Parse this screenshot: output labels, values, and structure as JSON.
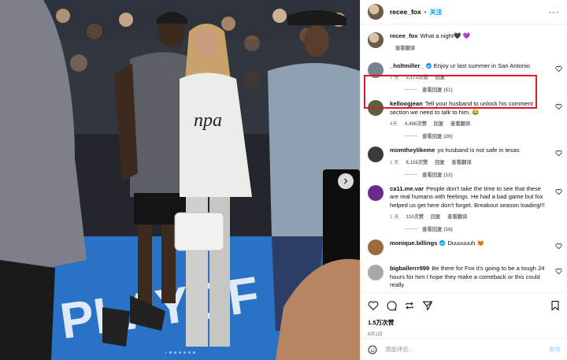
{
  "post": {
    "owner": "recee_fox",
    "follow_label": "关注",
    "more_icon": "more-horizontal-icon",
    "image_alt": "Two people posing on a basketball court after a game"
  },
  "caption": {
    "user": "recee_fox",
    "text": "What a night🖤 💜"
  },
  "comments": [
    {
      "user": "_holtmiller_",
      "verified": true,
      "text": "Enjoy ur last summer in San Antonio",
      "time": "1 天",
      "likes": "3,173次赞",
      "reply": "回复",
      "translate": "",
      "view_replies": "查看回复 (51)",
      "avatar_color": "#7a8391"
    },
    {
      "user": "kelloogjean",
      "verified": false,
      "text": "Tell your husband to unlock his comment section we need to talk to him. 😂",
      "time": "4天",
      "likes": "4,486次赞",
      "reply": "回复",
      "translate": "查看翻译",
      "view_replies": "查看回复 (26)",
      "avatar_color": "#55643d"
    },
    {
      "user": "momtheylikeme",
      "verified": false,
      "text": "yo husband is not safe in texas",
      "time": "1 天",
      "likes": "8,116次赞",
      "reply": "回复",
      "translate": "查看翻译",
      "view_replies": "查看回复 (12)",
      "avatar_color": "#3b3b3b"
    },
    {
      "user": "ca11.me.var",
      "verified": false,
      "text": "People don't take the time to see that these are real humans with feelings. He had a bad game but fox helped us get here don't forget. Breakout season loading!!!",
      "time": "1 天",
      "likes": "110次赞",
      "reply": "回复",
      "translate": "查看翻译",
      "view_replies": "查看回复 (18)",
      "avatar_color": "#6a2b8a"
    },
    {
      "user": "monique.billings",
      "verified": true,
      "text": "Duuuuuuh 😻",
      "time": "",
      "likes": "",
      "reply": "",
      "translate": "",
      "view_replies": "",
      "avatar_color": "#9b6b3c"
    },
    {
      "user": "bigballerrr999",
      "verified": false,
      "text": "Be there for Fox it's going to be a tough 24 hours for him I hope they make a comeback or this could really",
      "time": "",
      "likes": "",
      "reply": "",
      "translate": "",
      "view_replies": "",
      "avatar_color": "#a8a8a8"
    }
  ],
  "caption_meta": {
    "translate": "查看翻译"
  },
  "actions": {
    "likes": "1.5万次赞",
    "date": "6月1日",
    "add_comment_placeholder": "添加评论...",
    "post_label": "发布"
  }
}
